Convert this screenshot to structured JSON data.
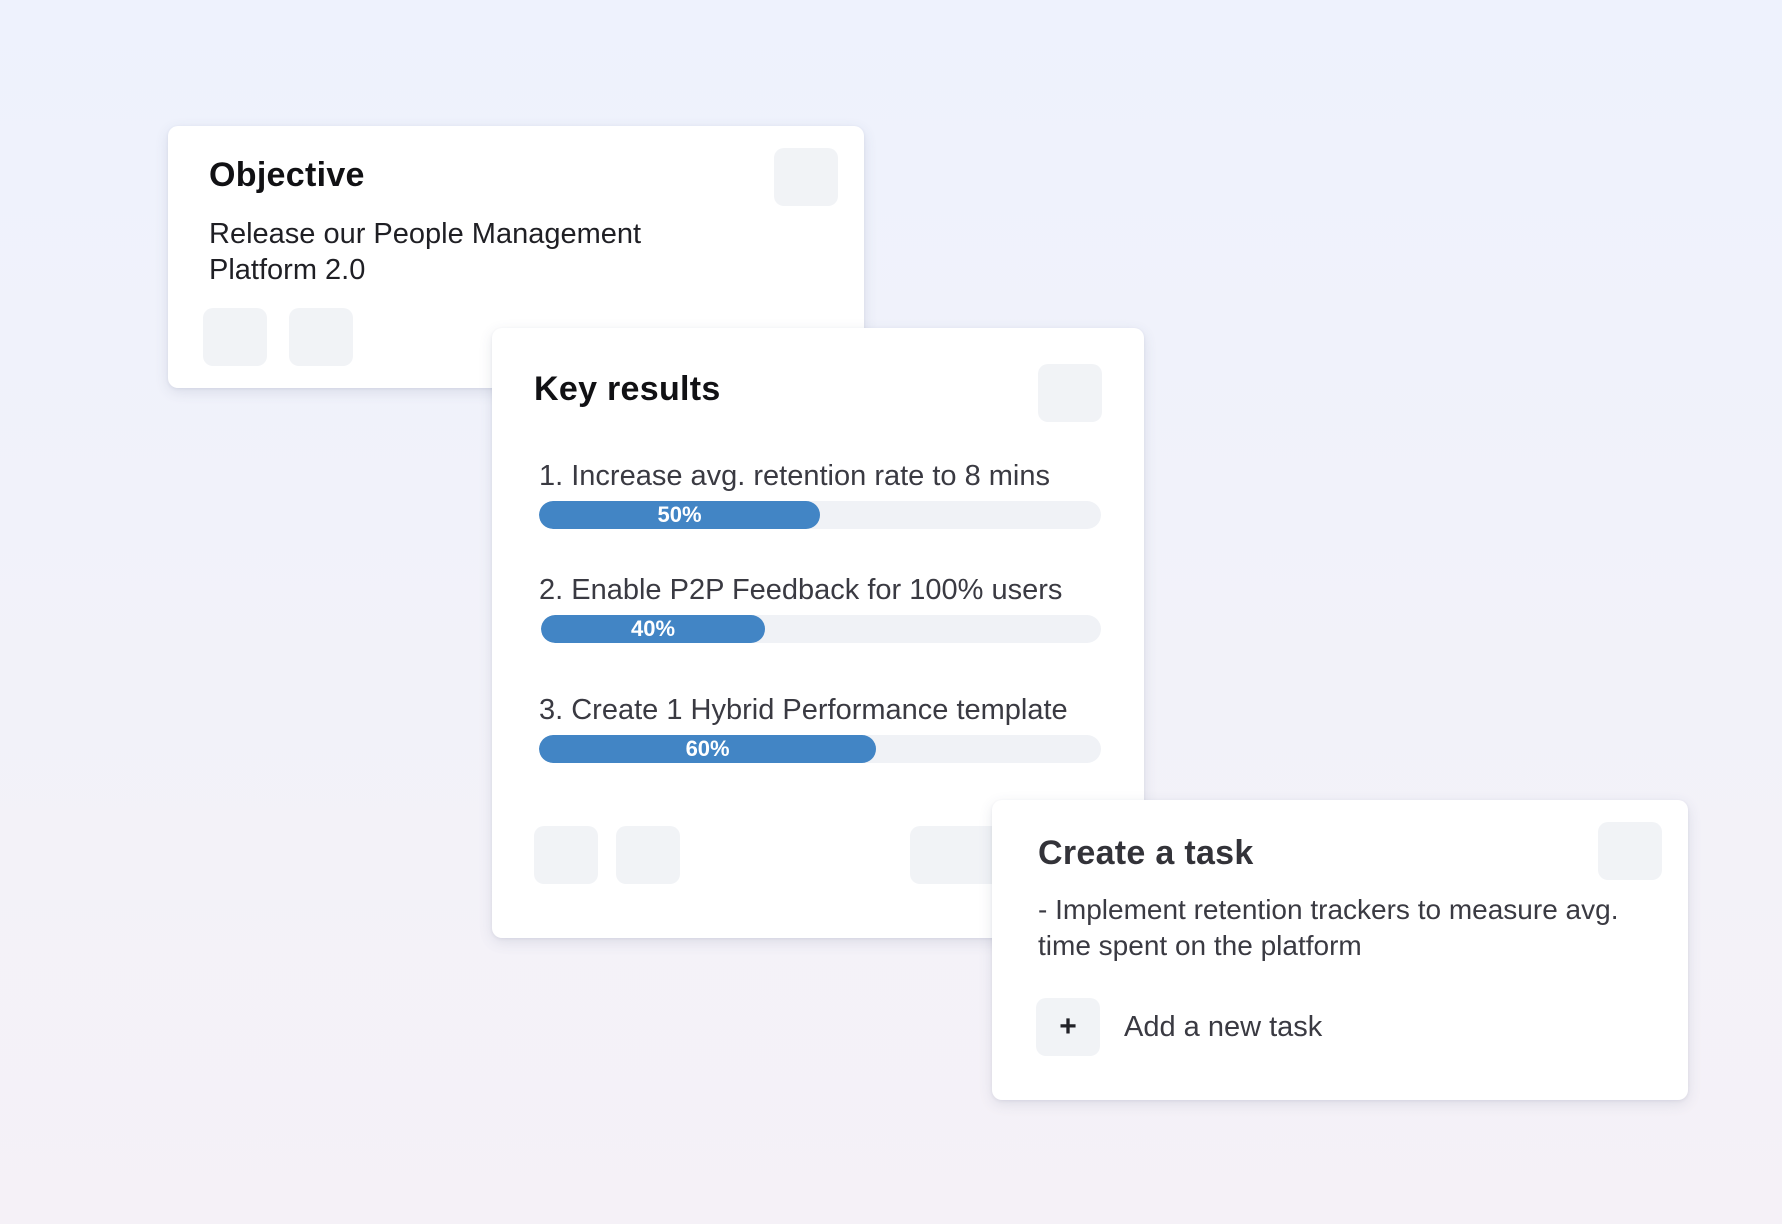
{
  "objective": {
    "title": "Objective",
    "description": "Release our People Management Platform 2.0"
  },
  "key_results": {
    "title": "Key results",
    "items": [
      {
        "label": "1. Increase avg. retention rate to 8 mins",
        "progress": 0.5,
        "progress_label": "50%"
      },
      {
        "label": "2. Enable P2P Feedback for 100% users",
        "progress": 0.4,
        "progress_label": "40%"
      },
      {
        "label": "3. Create 1 Hybrid Performance template",
        "progress": 0.6,
        "progress_label": "60%"
      }
    ]
  },
  "task": {
    "title": "Create a task",
    "task_text": "- Implement retention trackers to measure avg. time spent on the platform",
    "add_icon": "plus-icon",
    "add_label": "Add a new task"
  },
  "colors": {
    "progress_fill": "#4285c5",
    "progress_track": "#f0f2f6",
    "placeholder": "#f1f3f6"
  }
}
